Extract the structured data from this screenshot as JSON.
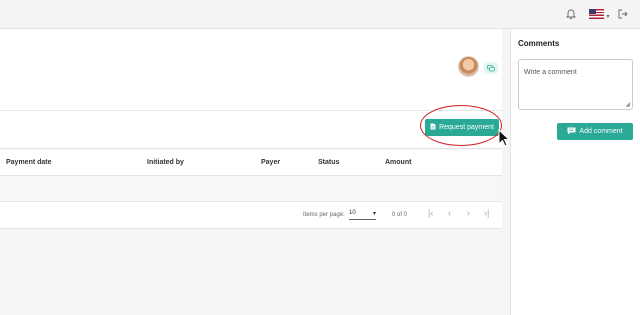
{
  "topbar": {
    "bell_icon": "bell-icon",
    "flag_icon": "us-flag-icon",
    "caret": "▾",
    "logout_icon": "logout-icon"
  },
  "header": {
    "avatar_icon": "user-avatar",
    "chip_icon": "message-icon"
  },
  "actions": {
    "request_payment_label": "Request payment"
  },
  "table": {
    "columns": [
      "Payment date",
      "Initiated by",
      "Payer",
      "Status",
      "Amount"
    ],
    "rows": []
  },
  "pagination": {
    "items_per_page_label": "Items per page:",
    "items_per_page_value": "10",
    "range_label": "0 of 0"
  },
  "comments": {
    "title": "Comments",
    "placeholder": "Write a comment",
    "add_label": "Add comment"
  },
  "colors": {
    "accent": "#2aa996",
    "annotation": "#d21f26"
  }
}
